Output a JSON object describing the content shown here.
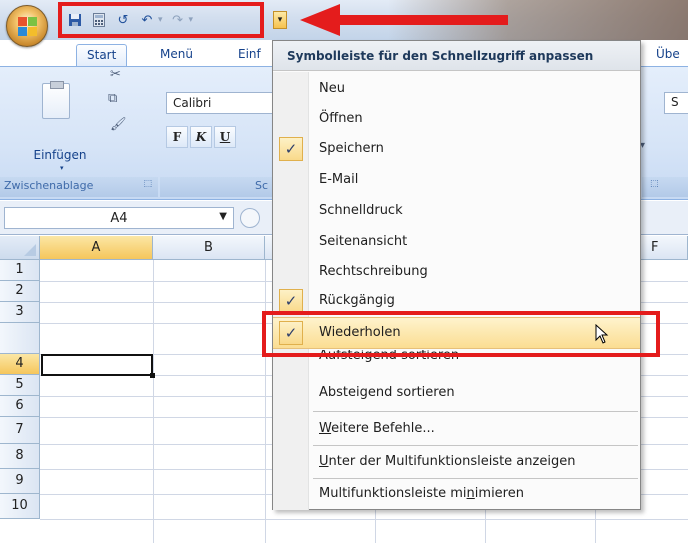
{
  "qat": {
    "save_icon": "save-icon",
    "calc_icon": "calculator-icon",
    "undo_icon": "undo-icon",
    "redo_icon": "redo-icon",
    "undo_glyph": "↺",
    "undo2_glyph": "↶",
    "redo_glyph": "↷",
    "drop_glyph": "▾",
    "small_dd": "▾",
    "customize_glyph": "▾"
  },
  "tabs": [
    "Start",
    "Menü",
    "Einf",
    "Übe"
  ],
  "ribbon": {
    "paste_label": "Einfügen",
    "paste_caret": "▾",
    "clipboard_caption": "Zwischenablage",
    "clipboard_launcher": "⬚",
    "font_caption_partial": "Sc",
    "font_name": "Calibri",
    "bold": "F",
    "italic": "K",
    "underline": "U",
    "launcher2": "⬚",
    "partial_right": "S"
  },
  "formula_bar": {
    "name_box": "A4",
    "dropdown": "▼"
  },
  "grid": {
    "columns": [
      "A",
      "B",
      "F"
    ],
    "rows": [
      "1",
      "2",
      "3",
      "4",
      "5",
      "6",
      "7",
      "8",
      "9",
      "10"
    ],
    "active_row": "4",
    "active_column": "A"
  },
  "menu": {
    "title": "Symbolleiste für den Schnellzugriff anpassen",
    "items": [
      {
        "label": "Neu",
        "checked": false
      },
      {
        "label": "Öffnen",
        "checked": false
      },
      {
        "label": "Speichern",
        "checked": true
      },
      {
        "label": "E-Mail",
        "checked": false
      },
      {
        "label": "Schnelldruck",
        "checked": false
      },
      {
        "label": "Seitenansicht",
        "checked": false
      },
      {
        "label": "Rechtschreibung",
        "checked": false
      },
      {
        "label": "Rückgängig",
        "checked": true
      },
      {
        "label": "Wiederholen",
        "checked": true
      },
      {
        "label": "Aufsteigend sortieren",
        "checked": false
      },
      {
        "label": "Absteigend sortieren",
        "checked": false
      }
    ],
    "more_commands_pre": "",
    "more_commands_u": "W",
    "more_commands_post": "eitere Befehle...",
    "below_ribbon_u": "U",
    "below_ribbon_post": "nter der Multifunktionsleiste anzeigen",
    "minimize_pre": "Multifunktionsleiste mi",
    "minimize_u": "n",
    "minimize_post": "imieren",
    "check_glyph": "✓"
  },
  "colors": {
    "highlight_red": "#e41c1c",
    "menu_hover": "#fbdd92",
    "ribbon_blue": "#d6e4f7"
  }
}
